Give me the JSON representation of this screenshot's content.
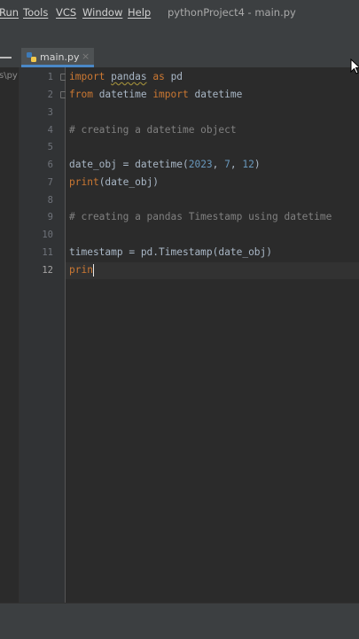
{
  "menubar": {
    "items": [
      "Run",
      "Tools",
      "VCS",
      "Window",
      "Help"
    ],
    "window_title": "pythonProject4 - main.py"
  },
  "tabs": [
    {
      "label": "main.py",
      "close": "×",
      "icon": "python-file-icon",
      "active": true
    }
  ],
  "project_panel": {
    "fragment": "s\\py"
  },
  "editor": {
    "current_line": 12,
    "line_numbers": [
      "1",
      "2",
      "3",
      "4",
      "5",
      "6",
      "7",
      "8",
      "9",
      "10",
      "11",
      "12"
    ],
    "lines": [
      "import pandas as pd",
      "from datetime import datetime",
      "",
      "# creating a datetime object",
      "",
      "date_obj = datetime(2023, 7, 12)",
      "print(date_obj)",
      "",
      "# creating a pandas Timestamp using datetime",
      "",
      "timestamp = pd.Timestamp(date_obj)",
      "prin"
    ]
  },
  "colors": {
    "background": "#2b2b2b",
    "keyword": "#cc7832",
    "comment": "#808080",
    "number": "#6897bb",
    "text": "#a9b7c6",
    "tab_underline": "#4a88c7"
  }
}
